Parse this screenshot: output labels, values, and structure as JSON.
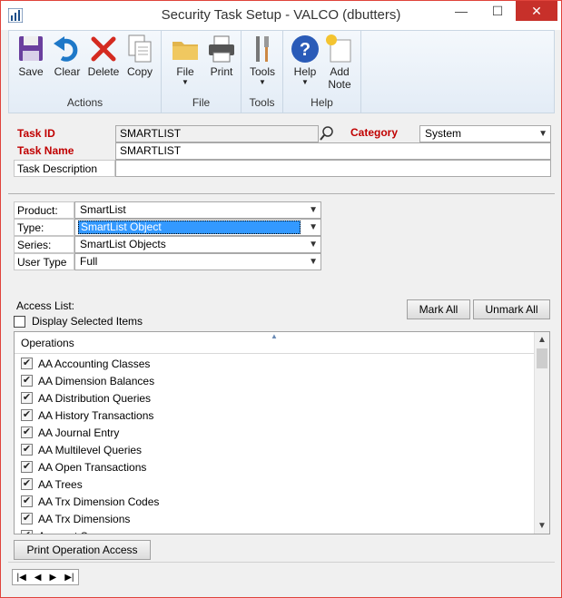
{
  "window": {
    "title": "Security Task Setup  -  VALCO (dbutters)",
    "minimize_glyph": "—",
    "maximize_glyph": "☐",
    "close_glyph": "✕"
  },
  "ribbon": {
    "groups": {
      "actions": "Actions",
      "file": "File",
      "tools": "Tools",
      "help": "Help"
    },
    "buttons": {
      "save": "Save",
      "clear": "Clear",
      "delete": "Delete",
      "copy": "Copy",
      "file": "File",
      "print": "Print",
      "tools": "Tools",
      "help": "Help",
      "add_note_line1": "Add",
      "add_note_line2": "Note"
    },
    "dropdown_glyph": "▼"
  },
  "task": {
    "id_label": "Task ID",
    "id_value": "SMARTLIST",
    "name_label": "Task Name",
    "name_value": "SMARTLIST",
    "desc_label": "Task Description",
    "desc_value": "",
    "category_label": "Category",
    "category_value": "System"
  },
  "filters": {
    "product_label": "Product:",
    "product_value": "SmartList",
    "type_label": "Type:",
    "type_value": "SmartList Object",
    "series_label": "Series:",
    "series_value": "SmartList Objects",
    "usertype_label": "User Type",
    "usertype_value": "Full"
  },
  "access": {
    "label": "Access List:",
    "display_selected": "Display Selected Items",
    "mark_all": "Mark All",
    "unmark_all": "Unmark All",
    "column_header": "Operations",
    "items": [
      "AA Accounting Classes",
      "AA Dimension Balances",
      "AA Distribution Queries",
      "AA History Transactions",
      "AA Journal Entry",
      "AA Multilevel Queries",
      "AA Open Transactions",
      "AA Trees",
      "AA Trx Dimension Codes",
      "AA Trx Dimensions",
      "Account Summary"
    ],
    "check_glyph": "✔"
  },
  "footer": {
    "print_button": "Print Operation Access",
    "nav_first": "|◀",
    "nav_prev": "◀",
    "nav_next": "▶",
    "nav_last": "▶|"
  },
  "colors": {
    "accent_red": "#c00000",
    "selection_blue": "#3399ff",
    "close_red": "#c7302a"
  }
}
